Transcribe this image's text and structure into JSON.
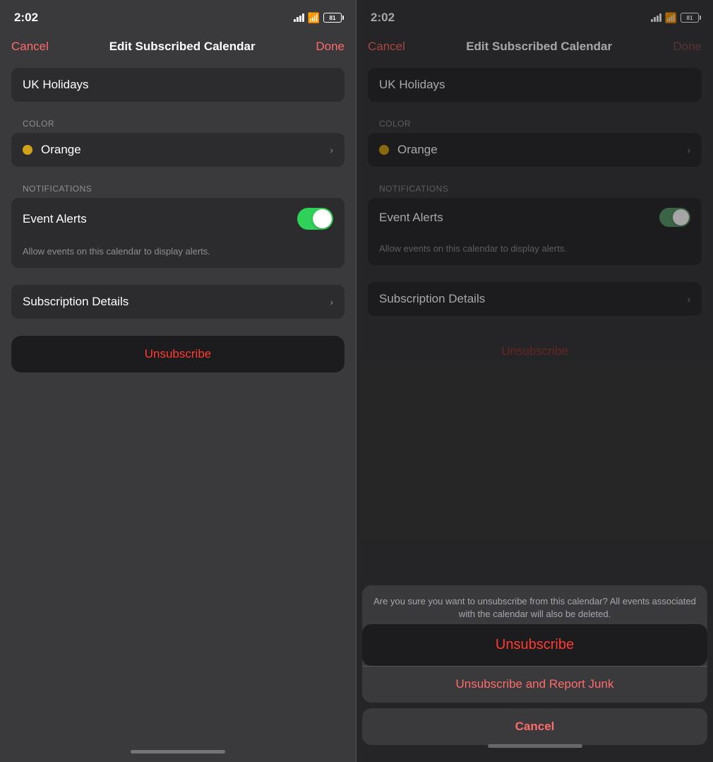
{
  "left_panel": {
    "status": {
      "time": "2:02",
      "battery": "81"
    },
    "nav": {
      "cancel": "Cancel",
      "title": "Edit Subscribed Calendar",
      "done": "Done"
    },
    "calendar_name": "UK Holidays",
    "color_section": {
      "label": "COLOR",
      "color_name": "Orange"
    },
    "notifications_section": {
      "label": "NOTIFICATIONS",
      "event_alerts_label": "Event Alerts",
      "alert_description": "Allow events on this calendar to display alerts."
    },
    "subscription_details": "Subscription Details",
    "unsubscribe": "Unsubscribe"
  },
  "right_panel": {
    "status": {
      "time": "2:02",
      "battery": "81"
    },
    "nav": {
      "cancel": "Cancel",
      "title": "Edit Subscribed Calendar",
      "done": "Done"
    },
    "calendar_name": "UK Holidays",
    "color_section": {
      "label": "COLOR",
      "color_name": "Orange"
    },
    "notifications_section": {
      "label": "NOTIFICATIONS",
      "event_alerts_label": "Event Alerts",
      "alert_description": "Allow events on this calendar to display alerts."
    },
    "subscription_details": "Subscription Details",
    "unsubscribe_dimmed": "Unsubscribe",
    "action_sheet": {
      "message": "Are you sure you want to unsubscribe from this calendar? All events associated with the calendar will also be deleted.",
      "unsubscribe_btn": "Unsubscribe",
      "report_junk_btn": "Unsubscribe and Report Junk",
      "cancel_btn": "Cancel"
    }
  }
}
